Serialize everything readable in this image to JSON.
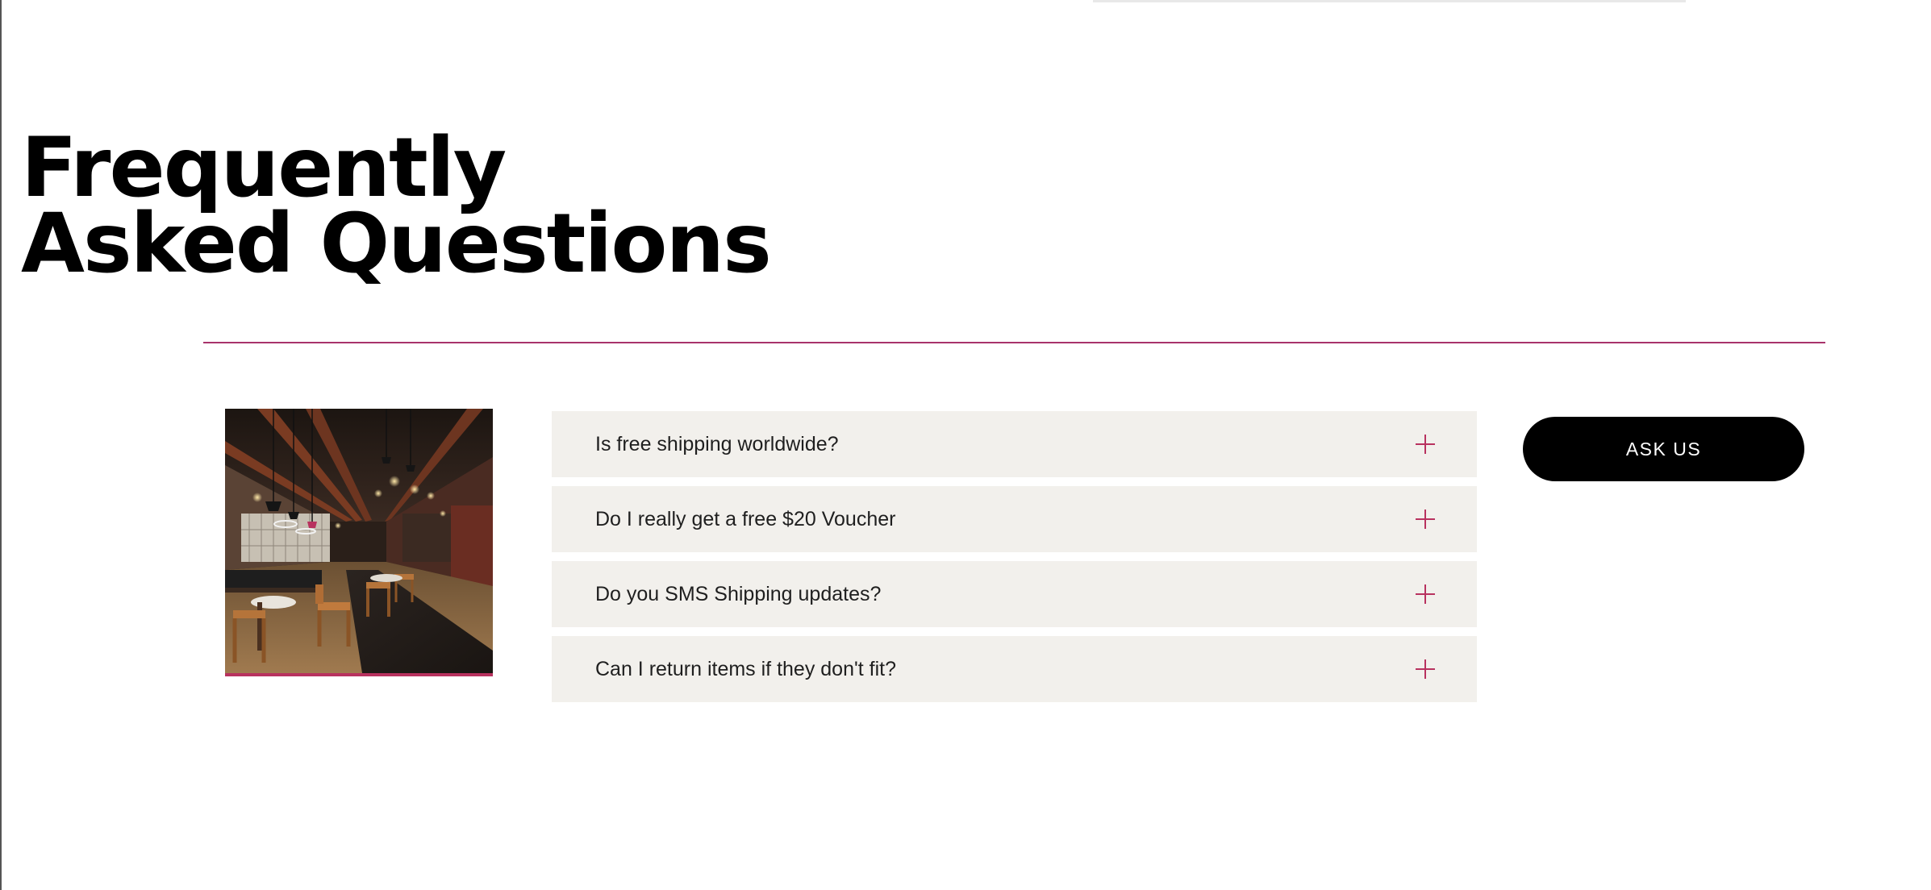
{
  "header": {
    "title_line1": "Frequently",
    "title_line2": "Asked Questions"
  },
  "colors": {
    "accent": "#b8325f",
    "divider": "#a8336b",
    "faq_background": "#f2f0ec",
    "button_background": "#000000",
    "button_text": "#ffffff"
  },
  "image": {
    "icon": "restaurant-interior-photo"
  },
  "faq": {
    "items": [
      {
        "question": "Is free shipping worldwide?",
        "icon": "plus-icon"
      },
      {
        "question": "Do I really get a free $20 Voucher",
        "icon": "plus-icon"
      },
      {
        "question": "Do you SMS Shipping updates?",
        "icon": "plus-icon"
      },
      {
        "question": "Can I return items if they don't fit?",
        "icon": "plus-icon"
      }
    ]
  },
  "cta": {
    "label": "ASK US"
  }
}
